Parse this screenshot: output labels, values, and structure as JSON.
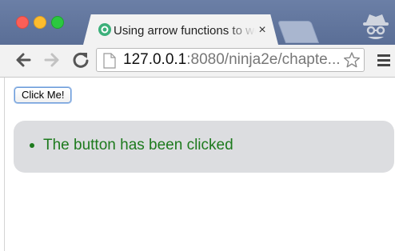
{
  "browser": {
    "tab": {
      "title": "Using arrow functions to work around function context",
      "close_symbol": "×"
    },
    "address_bar": {
      "host": "127.0.0.1",
      "path": ":8080/ninja2e/chapte..."
    },
    "icons": {
      "back": "back-arrow-icon",
      "forward": "forward-arrow-icon",
      "reload": "reload-icon",
      "page": "page-icon",
      "bookmark": "star-icon",
      "menu": "hamburger-menu-icon",
      "incognito": "incognito-icon",
      "favicon": "ninja-favicon-icon"
    },
    "colors": {
      "titlebar": "#5a6e96",
      "toolbar": "#f2f2f2",
      "result_text": "#1d7a1d",
      "result_panel": "#dcdde0"
    }
  },
  "page": {
    "button_label": "Click Me!",
    "results": [
      "The button has been clicked"
    ]
  }
}
